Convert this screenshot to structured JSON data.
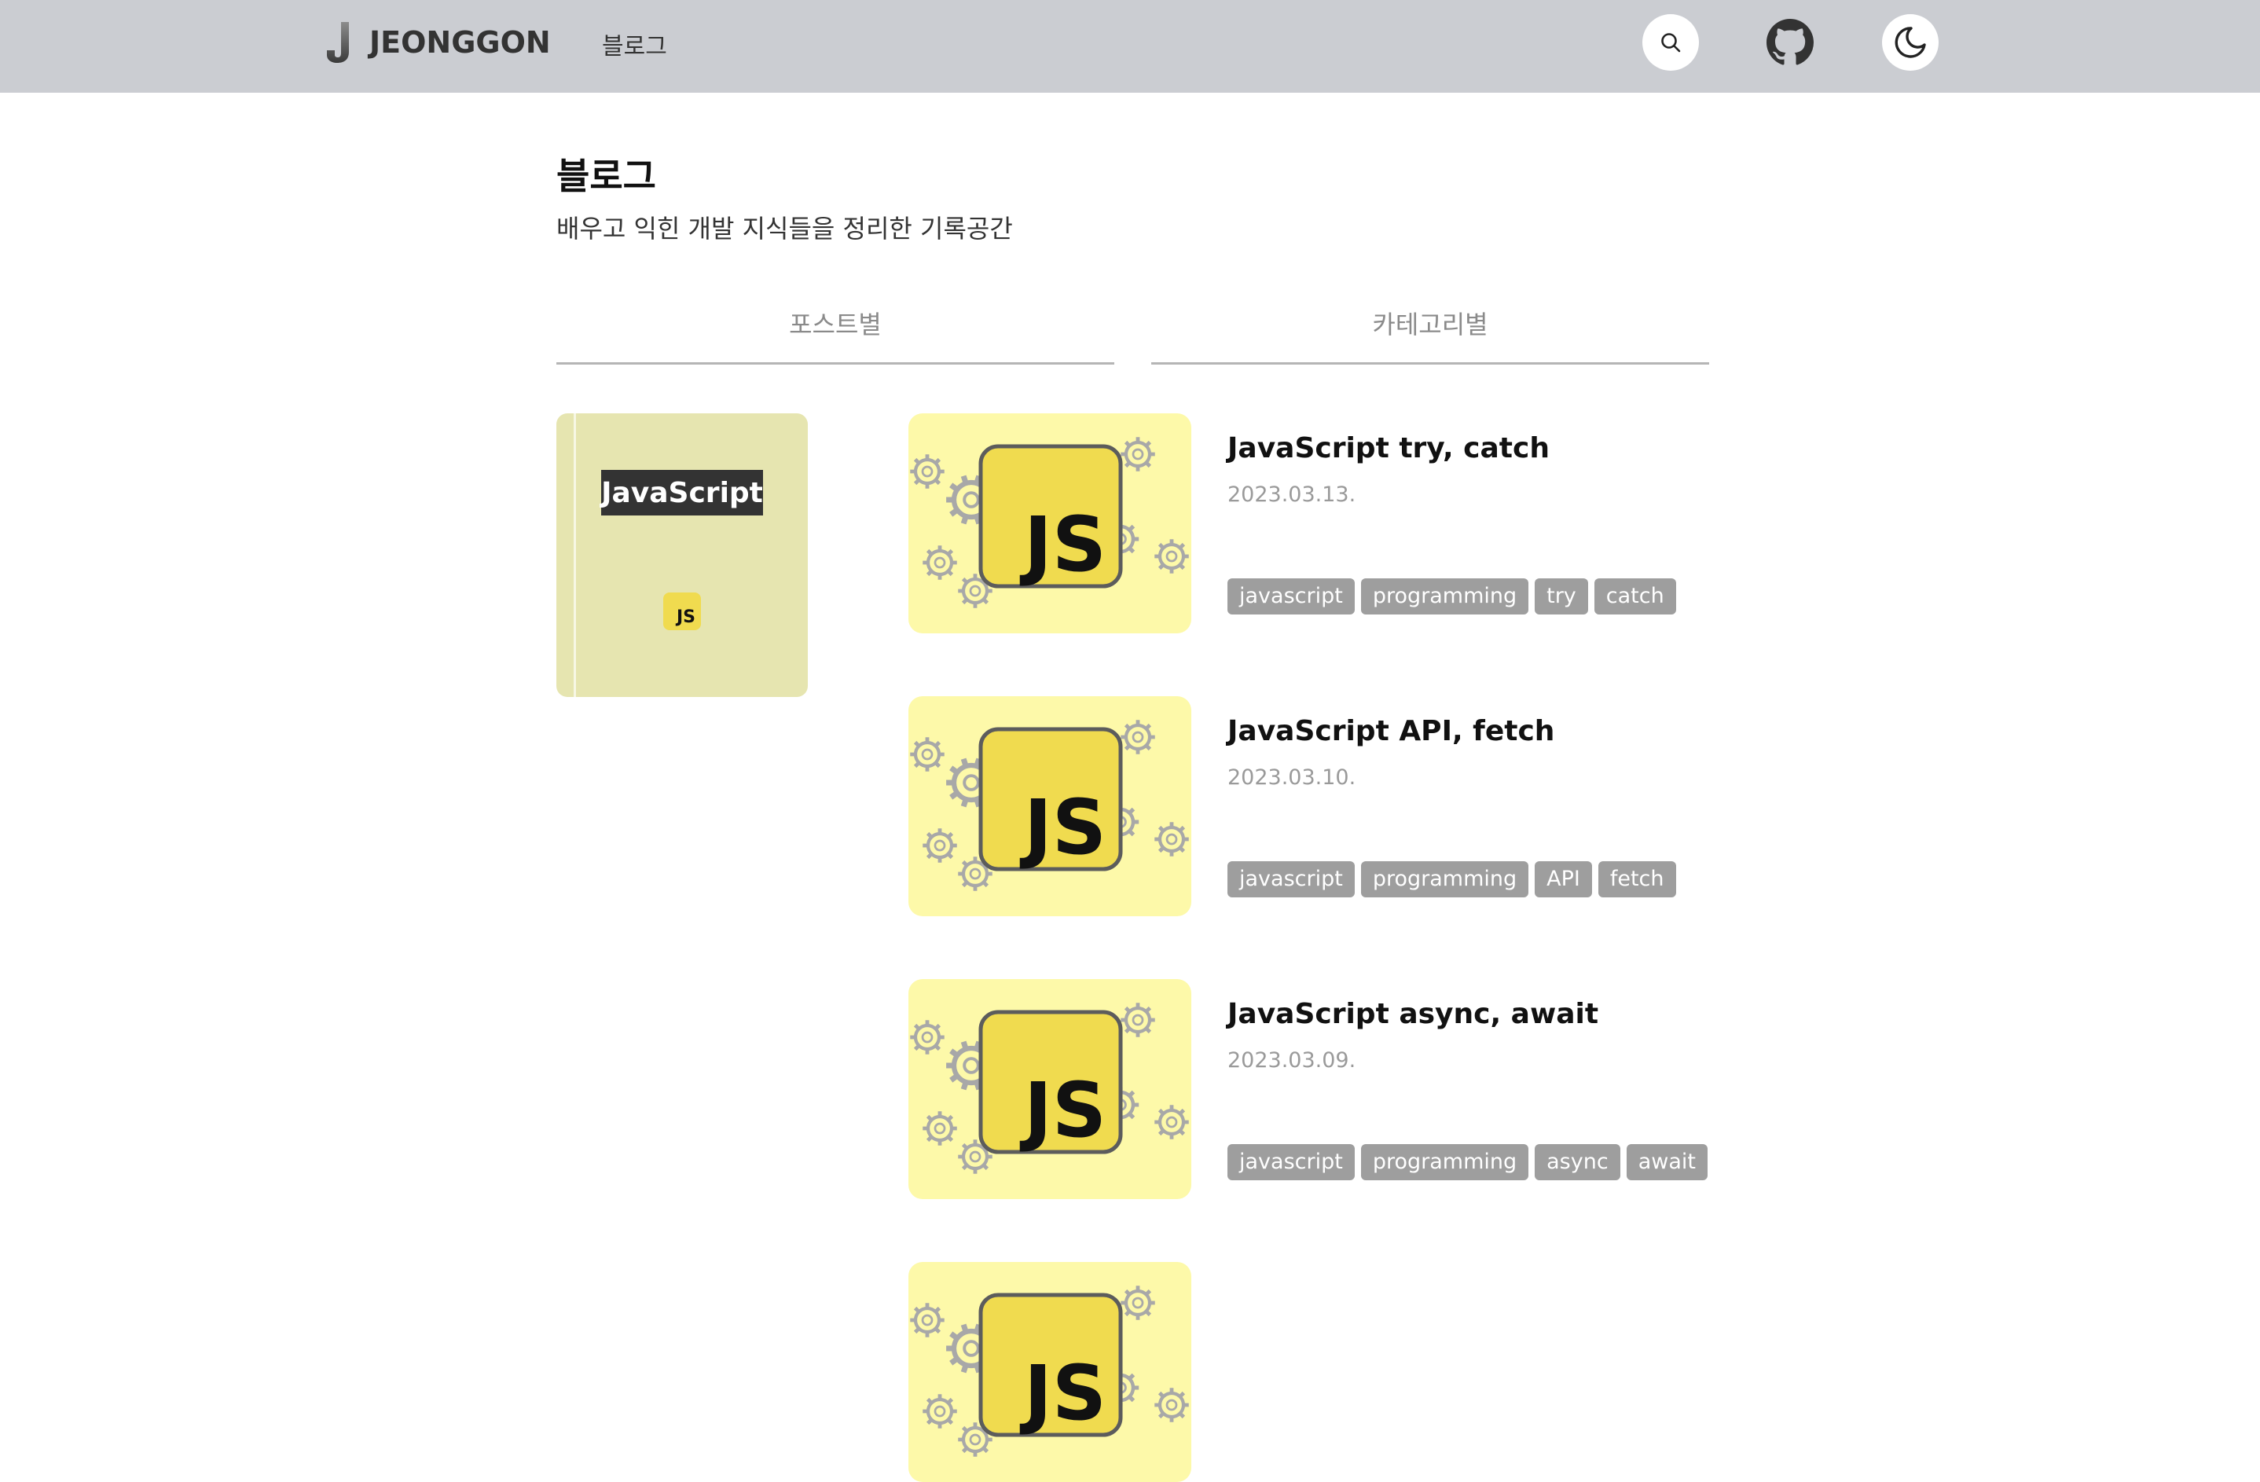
{
  "header": {
    "brand": "JEONGGON",
    "nav_blog": "블로그"
  },
  "page": {
    "title": "블로그",
    "description": "배우고 익힌 개발 지식들을 정리한 기록공간"
  },
  "tabs": [
    {
      "label": "포스트별"
    },
    {
      "label": "카테고리별"
    }
  ],
  "category": {
    "label": "JavaScript",
    "badge": "JS"
  },
  "posts": [
    {
      "thumb_text": "JS",
      "title": "JavaScript try, catch",
      "date": "2023.03.13.",
      "tags": [
        "javascript",
        "programming",
        "try",
        "catch"
      ]
    },
    {
      "thumb_text": "JS",
      "title": "JavaScript API, fetch",
      "date": "2023.03.10.",
      "tags": [
        "javascript",
        "programming",
        "API",
        "fetch"
      ]
    },
    {
      "thumb_text": "JS",
      "title": "JavaScript async, await",
      "date": "2023.03.09.",
      "tags": [
        "javascript",
        "programming",
        "async",
        "await"
      ]
    },
    {
      "thumb_text": "JS"
    }
  ],
  "icons": {
    "search": "search-icon",
    "github": "github-icon",
    "theme": "moon-icon",
    "logo": "logo-icon"
  },
  "colors": {
    "header_bg": "#cbcdd2",
    "thumb_bg": "#fdf9a9",
    "js_yellow": "#f0db4f",
    "category_bg": "#e6e5b0",
    "tag_bg": "#9e9e9e"
  }
}
